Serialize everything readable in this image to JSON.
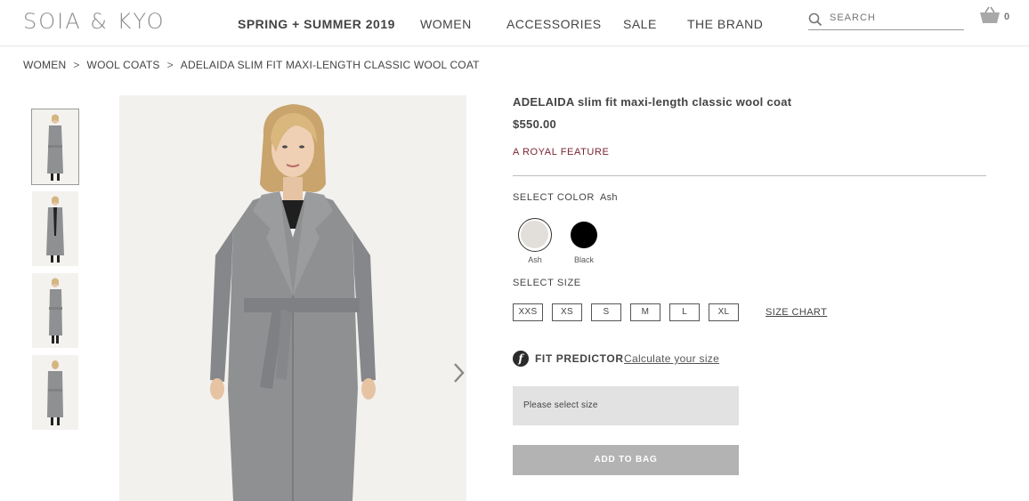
{
  "brand": {
    "logo": "SOIA & KYO"
  },
  "nav": {
    "items": [
      {
        "label": "SPRING + SUMMER 2019"
      },
      {
        "label": "WOMEN"
      },
      {
        "label": "ACCESSORIES"
      },
      {
        "label": "SALE"
      },
      {
        "label": "THE BRAND"
      }
    ]
  },
  "search": {
    "placeholder": "SEARCH",
    "icon": "search-icon"
  },
  "cart": {
    "icon": "basket-icon",
    "count": "0"
  },
  "breadcrumb": {
    "items": [
      "WOMEN",
      "WOOL COATS",
      "ADELAIDA SLIM FIT MAXI-LENGTH CLASSIC WOOL COAT"
    ],
    "separator": ">"
  },
  "product": {
    "title": "ADELAIDA slim fit maxi-length classic wool coat",
    "price": "$550.00",
    "feature": "A ROYAL FEATURE",
    "color_heading": "SELECT COLOR",
    "selected_color": "Ash",
    "colors": [
      {
        "label": "Ash",
        "hex": "#e2dfdb"
      },
      {
        "label": "Black",
        "hex": "#000000"
      }
    ],
    "size_heading": "SELECT SIZE",
    "sizes": [
      "XXS",
      "XS",
      "S",
      "M",
      "L",
      "XL"
    ],
    "size_chart_label": "SIZE CHART",
    "fit_predictor_label": "FIT PREDICTOR",
    "fit_predictor_icon": "f",
    "fit_predictor_link": "Calculate your size",
    "size_select_placeholder": "Please select size",
    "add_to_bag_label": "ADD TO BAG"
  },
  "gallery": {
    "thumbnail_count": 4,
    "next_icon": "chevron-right-icon"
  },
  "colors": {
    "accent_feature": "#7a2436",
    "button_disabled": "#b3b3b3",
    "select_bg": "#e2e2e2",
    "coat_gray": "#8e9092"
  }
}
